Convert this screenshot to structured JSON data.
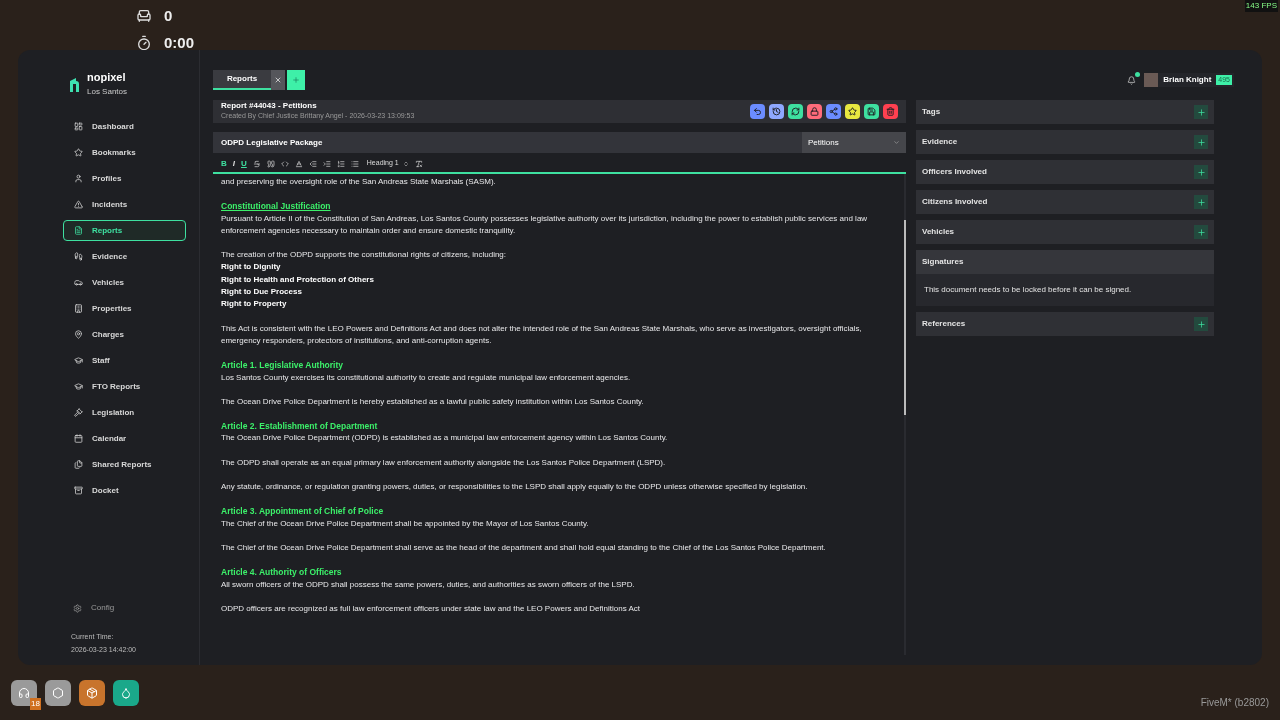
{
  "hud": {
    "seats": "0",
    "timer": "0:00",
    "fps": "143 FPS"
  },
  "brand": {
    "name": "nopixel",
    "subtitle": "Los Santos"
  },
  "nav": [
    {
      "label": "Dashboard",
      "selected": false
    },
    {
      "label": "Bookmarks",
      "selected": false
    },
    {
      "label": "Profiles",
      "selected": false
    },
    {
      "label": "Incidents",
      "selected": false
    },
    {
      "label": "Reports",
      "selected": true
    },
    {
      "label": "Evidence",
      "selected": false
    },
    {
      "label": "Vehicles",
      "selected": false
    },
    {
      "label": "Properties",
      "selected": false
    },
    {
      "label": "Charges",
      "selected": false
    },
    {
      "label": "Staff",
      "selected": false
    },
    {
      "label": "FTO Reports",
      "selected": false
    },
    {
      "label": "Legislation",
      "selected": false
    },
    {
      "label": "Calendar",
      "selected": false
    },
    {
      "label": "Shared Reports",
      "selected": false
    },
    {
      "label": "Docket",
      "selected": false
    }
  ],
  "config": "Config",
  "current_time": {
    "label": "Current Time:",
    "value": "2026-03-23 14:42:00"
  },
  "tabs": [
    {
      "label": "Reports",
      "selected": true
    }
  ],
  "report": {
    "title": "Report #44043 - Petitions",
    "created": "Created By Chief Justice Brittany Angel - 2026-03-23 13:09:53"
  },
  "actions": [
    {
      "color": "#6b8cff"
    },
    {
      "color": "#8fa8ff"
    },
    {
      "color": "#3ee0a0"
    },
    {
      "color": "#ff6b7a"
    },
    {
      "color": "#6b8cff"
    },
    {
      "color": "#e8e840"
    },
    {
      "color": "#3ee0a0"
    },
    {
      "color": "#ff4050"
    }
  ],
  "document": {
    "title": "ODPD Legislative Package",
    "category": "Petitions"
  },
  "format_tools": [
    {
      "label": "B",
      "active": true
    },
    {
      "label": "I",
      "active": false
    },
    {
      "label": "U",
      "active": true
    }
  ],
  "heading_select": "Heading 1",
  "paragraphs": [
    {
      "lines": [
        {
          "kind": "text",
          "text": "and preserving the oversight role of the San Andreas State Marshals (SASM)."
        }
      ]
    },
    {
      "lines": [
        {
          "kind": "heading",
          "underlined": true,
          "text": "Constitutional Justification"
        },
        {
          "kind": "text",
          "text": "Pursuant to Article II of the Constitution of San Andreas, Los Santos County possesses legislative authority over its jurisdiction, including the power to establish public services and law enforcement agencies necessary to maintain order and ensure domestic tranquility."
        }
      ]
    },
    {
      "lines": [
        {
          "kind": "text",
          "text": "The creation of the ODPD supports the constitutional rights of citizens, including:"
        },
        {
          "kind": "bold",
          "text": "Right to Dignity"
        },
        {
          "kind": "bold",
          "text": "Right to Health and Protection of Others"
        },
        {
          "kind": "bold",
          "text": "Right to Due Process"
        },
        {
          "kind": "bold",
          "text": "Right to Property"
        }
      ]
    },
    {
      "lines": [
        {
          "kind": "text",
          "text": "This Act is consistent with the LEO Powers and Definitions Act and does not alter the intended role of the San Andreas State Marshals, who serve as investigators, oversight officials, emergency responders, protectors of institutions, and anti-corruption agents."
        }
      ]
    },
    {
      "lines": [
        {
          "kind": "heading",
          "underlined": false,
          "text": "Article 1. Legislative Authority"
        },
        {
          "kind": "text",
          "text": "Los Santos County exercises its constitutional authority to create and regulate municipal law enforcement agencies."
        }
      ]
    },
    {
      "lines": [
        {
          "kind": "text",
          "text": "The Ocean Drive Police Department is hereby established as a lawful public safety institution within Los Santos County."
        }
      ]
    },
    {
      "lines": [
        {
          "kind": "heading",
          "underlined": false,
          "text": "Article 2. Establishment of Department"
        },
        {
          "kind": "text",
          "text": "The Ocean Drive Police Department (ODPD) is established as a municipal law enforcement agency within Los Santos County."
        }
      ]
    },
    {
      "lines": [
        {
          "kind": "text",
          "text": "The ODPD shall operate as an equal primary law enforcement authority alongside the Los Santos Police Department (LSPD)."
        }
      ]
    },
    {
      "lines": [
        {
          "kind": "text",
          "text": "Any statute, ordinance, or regulation granting powers, duties, or responsibilities to the LSPD shall apply equally to the ODPD unless otherwise specified by legislation."
        }
      ]
    },
    {
      "lines": [
        {
          "kind": "heading",
          "underlined": false,
          "text": "Article 3. Appointment of Chief of Police"
        },
        {
          "kind": "text",
          "text": "The Chief of the Ocean Drive Police Department shall be appointed by the Mayor of Los Santos County."
        }
      ]
    },
    {
      "lines": [
        {
          "kind": "text",
          "text": "The Chief of the Ocean Drive Police Department shall serve as the head of the department and shall hold equal standing to the Chief of the Los Santos Police Department."
        }
      ]
    },
    {
      "lines": [
        {
          "kind": "heading",
          "underlined": false,
          "text": "Article 4. Authority of Officers"
        },
        {
          "kind": "text",
          "text": "All sworn officers of the ODPD shall possess the same powers, duties, and authorities as sworn officers of the LSPD."
        }
      ]
    },
    {
      "lines": [
        {
          "kind": "text",
          "text": "ODPD officers are recognized as full law enforcement officers under state law and the LEO Powers and Definitions Act"
        }
      ]
    }
  ],
  "user": {
    "name": "Brian Knight",
    "badge": "495",
    "has_notification": true
  },
  "sections": [
    {
      "kind": "add",
      "title": "Tags"
    },
    {
      "kind": "add",
      "title": "Evidence"
    },
    {
      "kind": "add",
      "title": "Officers Involved"
    },
    {
      "kind": "add",
      "title": "Citizens Involved"
    },
    {
      "kind": "add",
      "title": "Vehicles"
    },
    {
      "kind": "note",
      "title": "Signatures",
      "note": "This document needs to be locked before it can be signed."
    },
    {
      "kind": "add",
      "title": "References"
    }
  ],
  "status_icons": [
    {
      "color": "#9a9a9a",
      "badge": "18"
    },
    {
      "color": "#9a9a9a"
    },
    {
      "color": "#c8742c"
    },
    {
      "color": "#1aa88a"
    }
  ],
  "footer": "FiveM* (b2802)"
}
